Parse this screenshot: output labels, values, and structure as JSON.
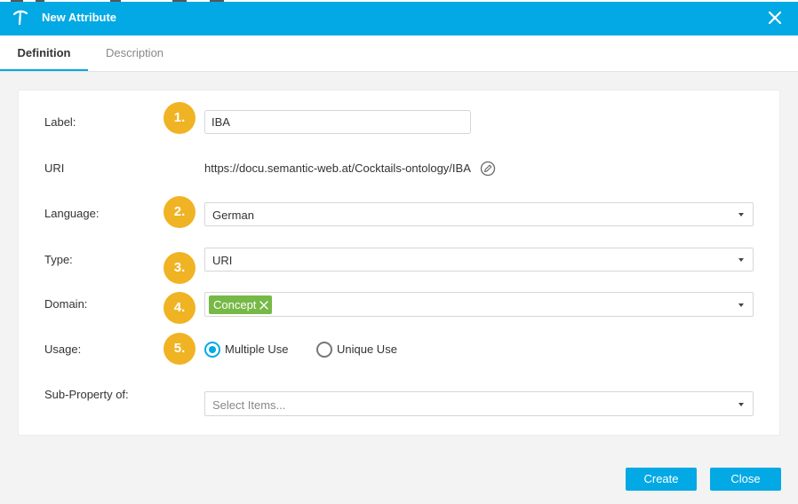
{
  "dialog": {
    "title": "New Attribute",
    "accent_color": "#03a9e4"
  },
  "tabs": [
    {
      "label": "Definition",
      "active": true
    },
    {
      "label": "Description",
      "active": false
    }
  ],
  "form": {
    "label": {
      "caption": "Label:",
      "value": "IBA",
      "step": "1."
    },
    "uri": {
      "caption": "URI",
      "value": "https://docu.semantic-web.at/Cocktails-ontology/IBA"
    },
    "language": {
      "caption": "Language:",
      "value": "German",
      "step": "2."
    },
    "type": {
      "caption": "Type:",
      "value": "URI",
      "step": "3."
    },
    "domain": {
      "caption": "Domain:",
      "chip": "Concept",
      "chip_color": "#76b947",
      "step": "4."
    },
    "usage": {
      "caption": "Usage:",
      "step": "5.",
      "options": [
        {
          "label": "Multiple Use",
          "selected": true
        },
        {
          "label": "Unique Use",
          "selected": false
        }
      ]
    },
    "sub_property": {
      "caption": "Sub-Property of:",
      "placeholder": "Select Items..."
    }
  },
  "step_badge_color": "#f0b323",
  "buttons": {
    "create": "Create",
    "close": "Close"
  }
}
